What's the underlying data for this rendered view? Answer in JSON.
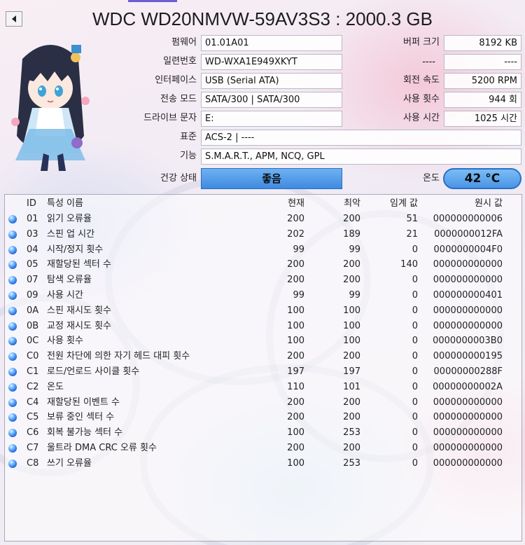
{
  "window": {
    "title": "WDC WD20NMVW-59AV3S3 : 2000.3 GB"
  },
  "info": {
    "firmware_label": "펌웨어",
    "firmware": "01.01A01",
    "serial_label": "일련번호",
    "serial": "WD-WXA1E949XKYT",
    "interface_label": "인터페이스",
    "interface": "USB (Serial ATA)",
    "transfer_label": "전송 모드",
    "transfer": "SATA/300 | SATA/300",
    "drive_label": "드라이브 문자",
    "drive": "E:",
    "standard_label": "표준",
    "standard": "ACS-2 | ----",
    "features_label": "기능",
    "features": "S.M.A.R.T., APM, NCQ, GPL",
    "buffer_label": "버퍼 크기",
    "buffer": "8192 KB",
    "blank1_left": "----",
    "blank1_right": "----",
    "rotation_label": "회전 속도",
    "rotation": "5200 RPM",
    "power_count_label": "사용 횟수",
    "power_count": "944 회",
    "power_hours_label": "사용 시간",
    "power_hours": "1025 시간",
    "health_label": "건강 상태",
    "health": "좋음",
    "temp_label": "온도",
    "temp": "42 °C"
  },
  "smart": {
    "headers": {
      "id": "ID",
      "name": "특성 이름",
      "current": "현재",
      "worst": "최악",
      "threshold": "임계 값",
      "raw": "원시 값"
    },
    "rows": [
      {
        "id": "01",
        "name": "읽기 오류율",
        "current": "200",
        "worst": "200",
        "threshold": "51",
        "raw": "000000000006"
      },
      {
        "id": "03",
        "name": "스핀 업 시간",
        "current": "202",
        "worst": "189",
        "threshold": "21",
        "raw": "0000000012FA"
      },
      {
        "id": "04",
        "name": "시작/정지 횟수",
        "current": "99",
        "worst": "99",
        "threshold": "0",
        "raw": "0000000004F0"
      },
      {
        "id": "05",
        "name": "재할당된 섹터 수",
        "current": "200",
        "worst": "200",
        "threshold": "140",
        "raw": "000000000000"
      },
      {
        "id": "07",
        "name": "탐색 오류율",
        "current": "200",
        "worst": "200",
        "threshold": "0",
        "raw": "000000000000"
      },
      {
        "id": "09",
        "name": "사용 시간",
        "current": "99",
        "worst": "99",
        "threshold": "0",
        "raw": "000000000401"
      },
      {
        "id": "0A",
        "name": "스핀 재시도 횟수",
        "current": "100",
        "worst": "100",
        "threshold": "0",
        "raw": "000000000000"
      },
      {
        "id": "0B",
        "name": "교정 재시도 횟수",
        "current": "100",
        "worst": "100",
        "threshold": "0",
        "raw": "000000000000"
      },
      {
        "id": "0C",
        "name": "사용 횟수",
        "current": "100",
        "worst": "100",
        "threshold": "0",
        "raw": "0000000003B0"
      },
      {
        "id": "C0",
        "name": "전원 차단에 의한 자기 헤드 대피 횟수",
        "current": "200",
        "worst": "200",
        "threshold": "0",
        "raw": "000000000195"
      },
      {
        "id": "C1",
        "name": "로드/언로드 사이클 횟수",
        "current": "197",
        "worst": "197",
        "threshold": "0",
        "raw": "00000000288F"
      },
      {
        "id": "C2",
        "name": "온도",
        "current": "110",
        "worst": "101",
        "threshold": "0",
        "raw": "00000000002A"
      },
      {
        "id": "C4",
        "name": "재할당된 이벤트 수",
        "current": "200",
        "worst": "200",
        "threshold": "0",
        "raw": "000000000000"
      },
      {
        "id": "C5",
        "name": "보류 중인 섹터 수",
        "current": "200",
        "worst": "200",
        "threshold": "0",
        "raw": "000000000000"
      },
      {
        "id": "C6",
        "name": "회복 불가능 섹터 수",
        "current": "100",
        "worst": "253",
        "threshold": "0",
        "raw": "000000000000"
      },
      {
        "id": "C7",
        "name": "울트라 DMA CRC 오류 횟수",
        "current": "200",
        "worst": "200",
        "threshold": "0",
        "raw": "000000000000"
      },
      {
        "id": "C8",
        "name": "쓰기 오류율",
        "current": "100",
        "worst": "253",
        "threshold": "0",
        "raw": "000000000000"
      }
    ]
  },
  "colors": {
    "status_good": "#3e8ae0",
    "accent": "#6b5fd1"
  }
}
